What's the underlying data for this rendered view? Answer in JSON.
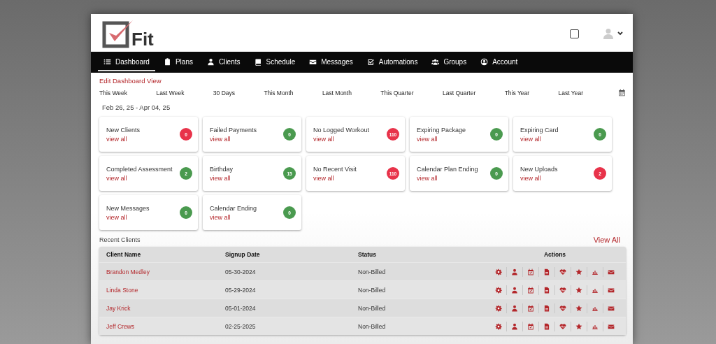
{
  "logo": {
    "text": "Fit"
  },
  "nav": [
    {
      "label": "Dashboard",
      "selected": true
    },
    {
      "label": "Plans",
      "selected": false
    },
    {
      "label": "Clients",
      "selected": false
    },
    {
      "label": "Schedule",
      "selected": false
    },
    {
      "label": "Messages",
      "selected": false
    },
    {
      "label": "Automations",
      "selected": false
    },
    {
      "label": "Groups",
      "selected": false
    },
    {
      "label": "Account",
      "selected": false
    }
  ],
  "edit_link": "Edit Dashboard View",
  "periods": [
    "This Week",
    "Last Week",
    "30 Days",
    "This Month",
    "Last Month",
    "This Quarter",
    "Last Quarter",
    "This Year",
    "Last Year"
  ],
  "date_range": "Feb 26, 25 - Apr 04, 25",
  "cards": [
    {
      "title": "New Clients",
      "link": "view all",
      "count": "0",
      "color": "#e8334a"
    },
    {
      "title": "Failed Payments",
      "link": "view all",
      "count": "0",
      "color": "#4a9a4f"
    },
    {
      "title": "No Logged Workout",
      "link": "view all",
      "count": "110",
      "color": "#e8334a"
    },
    {
      "title": "Expiring Package",
      "link": "view all",
      "count": "0",
      "color": "#4a9a4f"
    },
    {
      "title": "Expiring Card",
      "link": "view all",
      "count": "0",
      "color": "#4a9a4f"
    },
    {
      "title": "Completed Assessment",
      "link": "view all",
      "count": "2",
      "color": "#4a9a4f"
    },
    {
      "title": "Birthday",
      "link": "view all",
      "count": "15",
      "color": "#4a9a4f"
    },
    {
      "title": "No Recent Visit",
      "link": "view all",
      "count": "110",
      "color": "#e8334a"
    },
    {
      "title": "Calendar Plan Ending",
      "link": "view all",
      "count": "0",
      "color": "#4a9a4f"
    },
    {
      "title": "New Uploads",
      "link": "view all",
      "count": "2",
      "color": "#e8334a"
    },
    {
      "title": "New Messages",
      "link": "view all",
      "count": "0",
      "color": "#4a9a4f"
    },
    {
      "title": "Calendar Ending",
      "link": "view all",
      "count": "0",
      "color": "#4a9a4f"
    }
  ],
  "recent_clients": {
    "title": "Recent Clients",
    "view_all": "View All",
    "columns": [
      "Client Name",
      "Signup Date",
      "Status",
      "Actions"
    ],
    "rows": [
      {
        "name": "Brandon Medley",
        "signup": "05-30-2024",
        "status": "Non-Billed"
      },
      {
        "name": "Linda Stone",
        "signup": "05-29-2024",
        "status": "Non-Billed"
      },
      {
        "name": "Jay Krick",
        "signup": "05-01-2024",
        "status": "Non-Billed"
      },
      {
        "name": "Jeff Crews",
        "signup": "02-25-2025",
        "status": "Non-Billed"
      }
    ]
  }
}
